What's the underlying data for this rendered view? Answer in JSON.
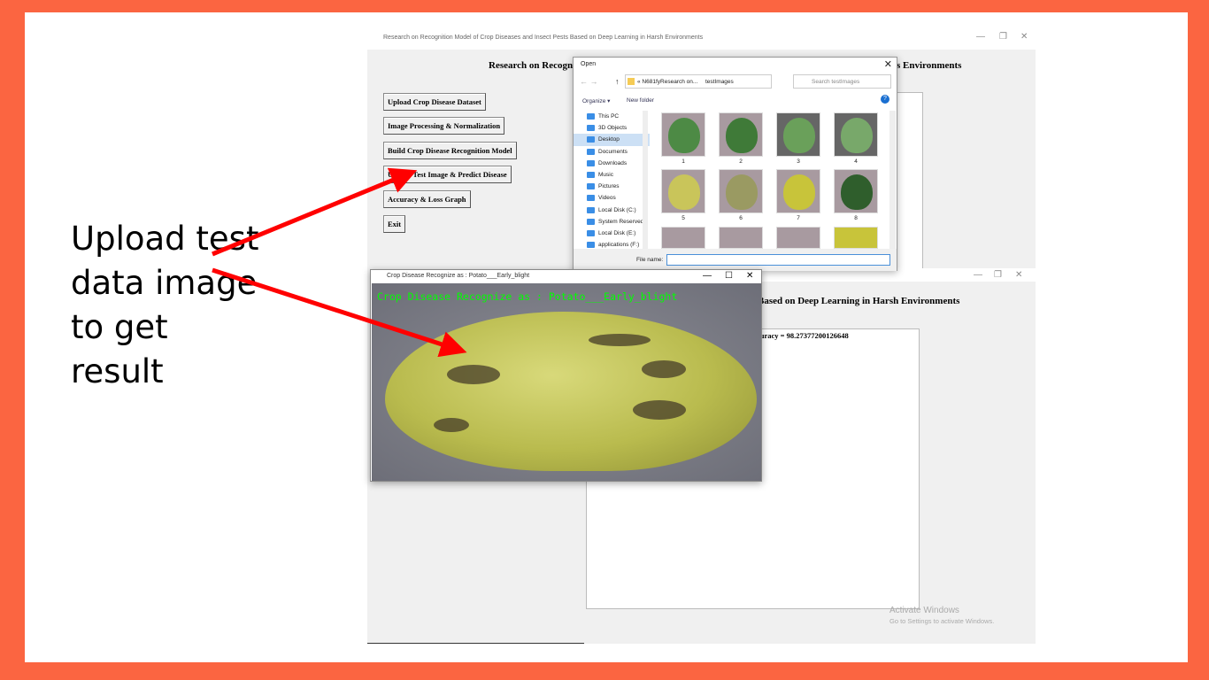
{
  "caption": "Upload test data image to get result",
  "app": {
    "title": "Research on Recognition Model of Crop Diseases and Insect Pests Based on Deep Learning in Harsh Environments",
    "heading_visible_left": "Research on Recogn",
    "heading_visible_right": "s Environments",
    "buttons": [
      "Upload Crop Disease Dataset",
      "Image Processing & Normalization",
      "Build Crop Disease Recognition Model",
      "Upload Test Image & Predict Disease",
      "Accuracy & Loss Graph",
      "Exit"
    ]
  },
  "app2": {
    "heading_visible": "Based on Deep Learning in Harsh Environments",
    "output_text": "curacy = 98.27377200126648"
  },
  "open_dialog": {
    "title": "Open",
    "path": [
      "« N681fyResearch on...",
      "testImages"
    ],
    "search_placeholder": "Search testImages",
    "organize": "Organize ▾",
    "new_folder": "New folder",
    "nav": [
      "This PC",
      "3D Objects",
      "Desktop",
      "Documents",
      "Downloads",
      "Music",
      "Pictures",
      "Videos",
      "Local Disk (C:)",
      "System Reserved",
      "Local Disk (E:)",
      "applications (F:)"
    ],
    "selected_nav": "Desktop",
    "files": [
      "1",
      "2",
      "3",
      "4",
      "5",
      "6",
      "7",
      "8"
    ],
    "file_name_label": "File name:",
    "file_name_value": ""
  },
  "result_window": {
    "title": "Crop Disease Recognize as : Potato___Early_blight",
    "overlay_text": "Crop Disease Recognize as : Potato___Early_blight"
  },
  "watermark": {
    "line1": "Activate Windows",
    "line2": "Go to Settings to activate Windows."
  },
  "colors": {
    "border": "#fb6541",
    "arrow": "#ff0000",
    "overlay": "#00ff00"
  }
}
